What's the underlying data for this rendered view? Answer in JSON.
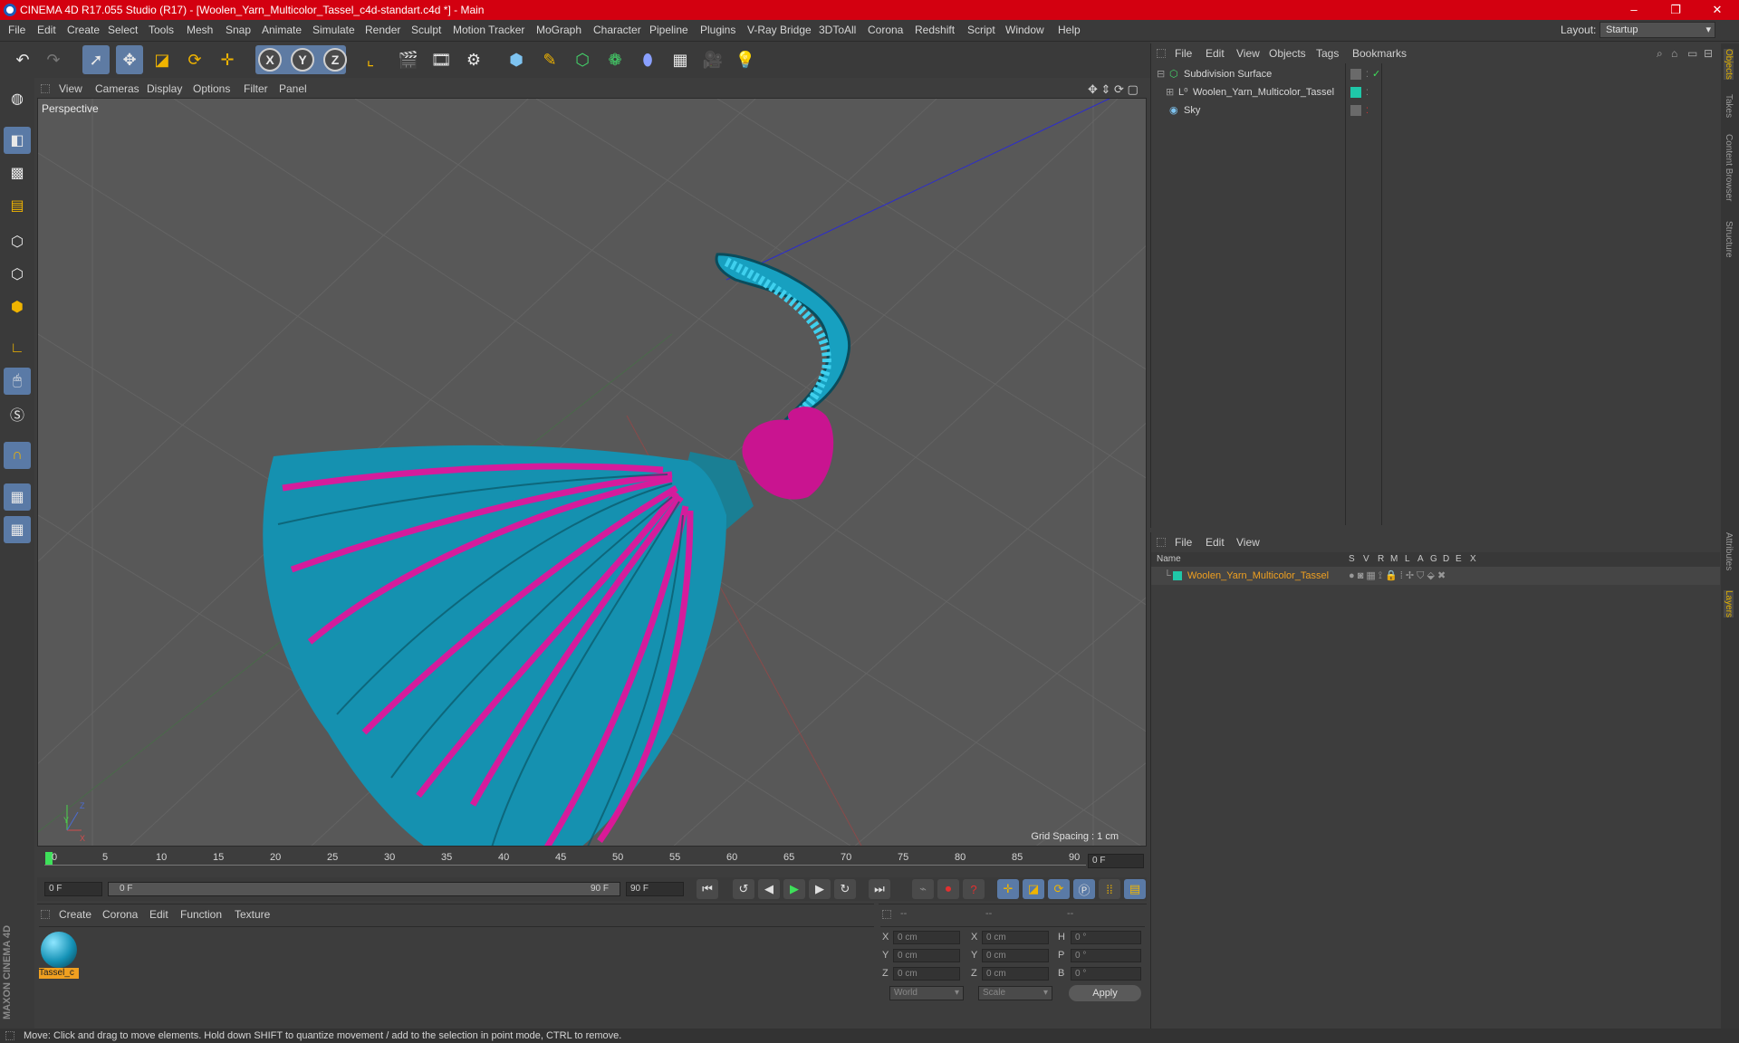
{
  "window": {
    "title": "CINEMA 4D R17.055 Studio (R17) - [Woolen_Yarn_Multicolor_Tassel_c4d-standart.c4d *] - Main",
    "minimize": "–",
    "maximize": "❐",
    "close": "✕"
  },
  "menu": [
    "File",
    "Edit",
    "Create",
    "Select",
    "Tools",
    "Mesh",
    "Snap",
    "Animate",
    "Simulate",
    "Render",
    "Sculpt",
    "Motion Tracker",
    "MoGraph",
    "Character",
    "Pipeline",
    "Plugins",
    "V-Ray Bridge",
    "3DToAll",
    "Corona",
    "Redshift",
    "Script",
    "Window",
    "Help"
  ],
  "layout": {
    "label": "Layout:",
    "value": "Startup"
  },
  "toolbar": {
    "axis_x": "X",
    "axis_y": "Y",
    "axis_z": "Z"
  },
  "viewport": {
    "menu": [
      "View",
      "Cameras",
      "Display",
      "Options",
      "Filter",
      "Panel"
    ],
    "label": "Perspective",
    "grid_spacing": "Grid Spacing : 1 cm",
    "axis_labels": {
      "x": "X",
      "y": "Y",
      "z": "Z"
    }
  },
  "timeline": {
    "ticks": [
      "0",
      "5",
      "10",
      "15",
      "20",
      "25",
      "30",
      "35",
      "40",
      "45",
      "50",
      "55",
      "60",
      "65",
      "70",
      "75",
      "80",
      "85",
      "90"
    ],
    "current_frame": "0 F",
    "start_field": "0 F",
    "range_start": "0 F",
    "range_end": "90 F",
    "end_field": "90 F"
  },
  "materials": {
    "menu": [
      "Create",
      "Corona",
      "Edit",
      "Function",
      "Texture"
    ],
    "items": [
      {
        "name": "Tassel_c"
      }
    ]
  },
  "coordinates": {
    "header": [
      "--",
      "--",
      "--"
    ],
    "rows": [
      {
        "l1": "X",
        "v1": "0 cm",
        "l2": "X",
        "v2": "0 cm",
        "l3": "H",
        "v3": "0 °"
      },
      {
        "l1": "Y",
        "v1": "0 cm",
        "l2": "Y",
        "v2": "0 cm",
        "l3": "P",
        "v3": "0 °"
      },
      {
        "l1": "Z",
        "v1": "0 cm",
        "l2": "Z",
        "v2": "0 cm",
        "l3": "B",
        "v3": "0 °"
      }
    ],
    "world": "World",
    "scale": "Scale",
    "apply": "Apply"
  },
  "objects": {
    "menu": [
      "File",
      "Edit",
      "View",
      "Objects",
      "Tags",
      "Bookmarks"
    ],
    "items": [
      {
        "name": "Subdivision Surface"
      },
      {
        "name": "Woolen_Yarn_Multicolor_Tassel"
      },
      {
        "name": "Sky"
      }
    ]
  },
  "layers": {
    "menu": [
      "File",
      "Edit",
      "View"
    ],
    "columns": [
      "Name",
      "S",
      "V",
      "R",
      "M",
      "L",
      "A",
      "G",
      "D",
      "E",
      "X"
    ],
    "items": [
      {
        "name": "Woolen_Yarn_Multicolor_Tassel"
      }
    ]
  },
  "side_tabs": [
    "Objects",
    "Takes",
    "Content Browser",
    "Structure",
    "Attributes",
    "Layers"
  ],
  "branding": "MAXON CINEMA 4D",
  "status": "Move: Click and drag to move elements. Hold down SHIFT to quantize movement / add to the selection in point mode, CTRL to remove.",
  "colors": {
    "title_bar": "#d30010",
    "accent_blue": "#5a7aa6",
    "yarn_teal": "#1aa3c4",
    "yarn_magenta": "#e0169b",
    "layer_color": "#1fc7a8"
  }
}
